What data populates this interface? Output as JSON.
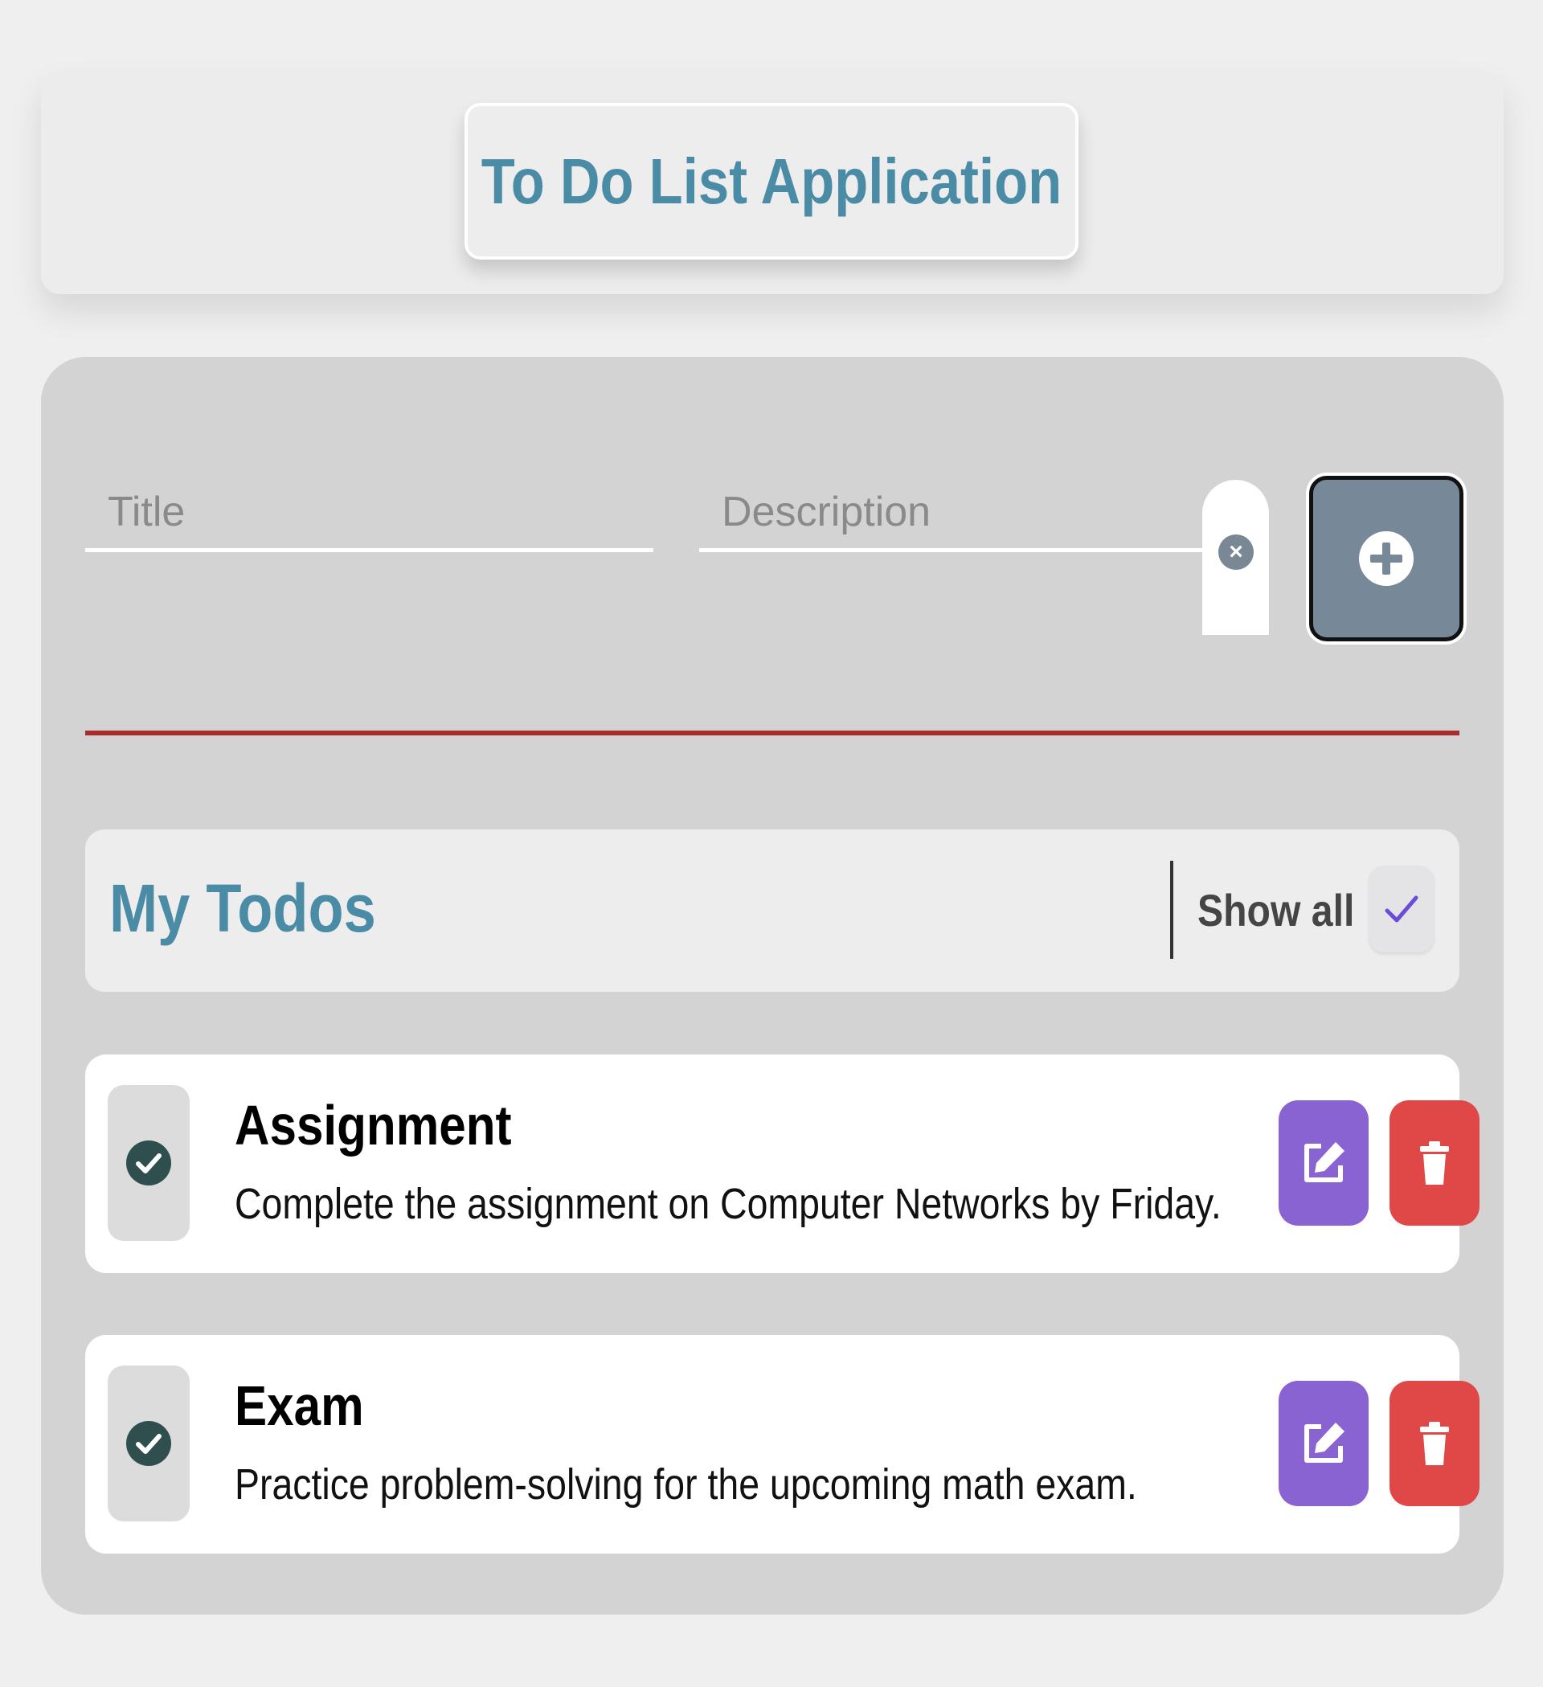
{
  "header": {
    "title": "To Do List Application"
  },
  "form": {
    "title_placeholder": "Title",
    "title_value": "",
    "description_placeholder": "Description",
    "description_value": "",
    "clear_icon": "x-icon",
    "add_icon": "plus-circle-icon"
  },
  "todos_section": {
    "heading": "My Todos",
    "show_all_label": "Show all",
    "show_all_checked": true
  },
  "todos": [
    {
      "title": "Assignment",
      "description": "Complete the assignment on Computer Networks by Friday.",
      "completed": true
    },
    {
      "title": "Exam",
      "description": "Practice problem-solving for the upcoming math exam.",
      "completed": true
    }
  ],
  "colors": {
    "accent": "#4a8ba6",
    "add_button": "#778899",
    "divider": "#a92b2b",
    "edit_button": "#8a63d2",
    "delete_button": "#e04848",
    "check_circle": "#2f4f4f",
    "show_all_check": "#6c4bd9"
  }
}
